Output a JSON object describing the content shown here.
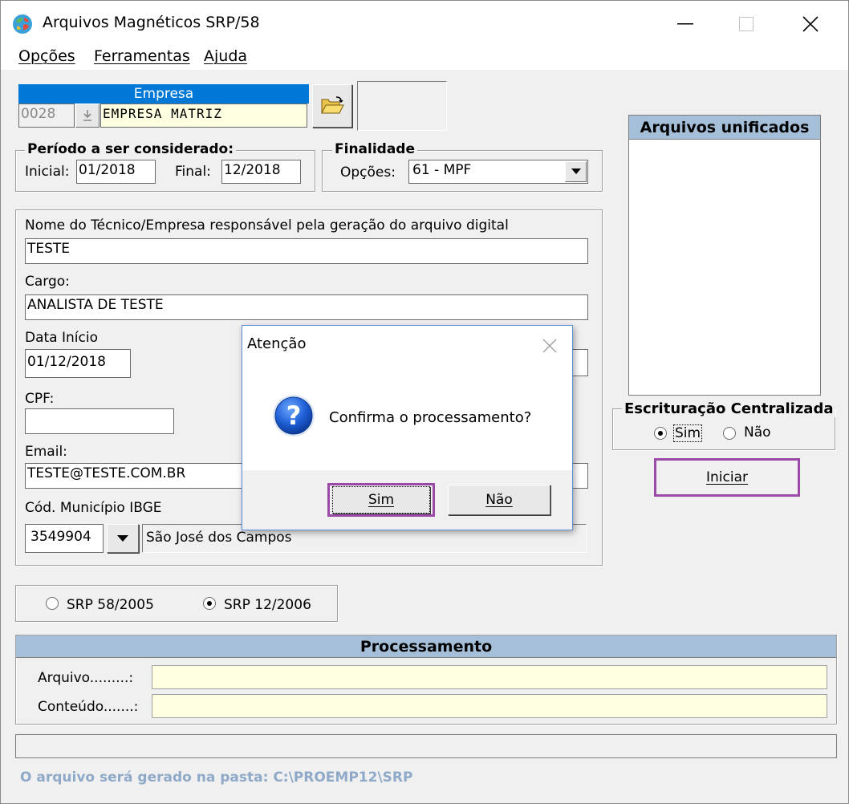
{
  "window": {
    "title": "Arquivos Magnéticos SRP/58",
    "minimize_glyph": "—",
    "maximize_glyph": "☐",
    "close_glyph": "✕"
  },
  "menu": [
    "Opções",
    "Ferramentas",
    "Ajuda"
  ],
  "empresa": {
    "header": "Empresa",
    "code": "0028",
    "name": "EMPRESA MATRIZ",
    "open_icon": "open-folder-icon"
  },
  "periodo": {
    "legend": "Período a ser considerado:",
    "inicial_label": "Inicial:",
    "inicial_value": "01/2018",
    "final_label": "Final:",
    "final_value": "12/2018"
  },
  "finalidade": {
    "legend": "Finalidade",
    "opcoes_label": "Opções:",
    "opcoes_value": "61 - MPF"
  },
  "responsavel": {
    "nome_label": "Nome do Técnico/Empresa responsável pela geração do arquivo digital",
    "nome_value": "TESTE",
    "cargo_label": "Cargo:",
    "cargo_value": "ANALISTA DE TESTE",
    "data_label": "Data Início",
    "data_value": "01/12/2018",
    "cpf_label": "CPF:",
    "cpf_value": "",
    "email_label": "Email:",
    "email_value": "TESTE@TESTE.COM.BR",
    "ibge_label": "Cód. Município IBGE",
    "ibge_code": "3549904",
    "ibge_city": "São José dos Campos"
  },
  "arquivos_unificados": {
    "header": "Arquivos unificados"
  },
  "escrituracao": {
    "legend": "Escrituração Centralizada",
    "sim": "Sim",
    "nao": "Não",
    "selected": "Sim"
  },
  "iniciar_label": "Iniciar",
  "srp": {
    "option1": "SRP 58/2005",
    "option2": "SRP 12/2006",
    "selected": "SRP 12/2006"
  },
  "processamento": {
    "header": "Processamento",
    "arquivo_label": "Arquivo.........:",
    "arquivo_value": "",
    "conteudo_label": "Conteúdo.......:",
    "conteudo_value": ""
  },
  "footer_note": "O arquivo será gerado na pasta: C:\\PROEMP12\\SRP",
  "dialog": {
    "title": "Atenção",
    "message": "Confirma o processamento?",
    "icon": "question-icon",
    "yes_label": "Sim",
    "no_label": "Não",
    "close_glyph": "✕"
  },
  "colors": {
    "highlight": "#9b4aa8",
    "empresa_header": "#0078d7",
    "section_header": "#a6bfd9",
    "yellow_field": "#ffffe1",
    "note_text": "#8fa9c8"
  }
}
